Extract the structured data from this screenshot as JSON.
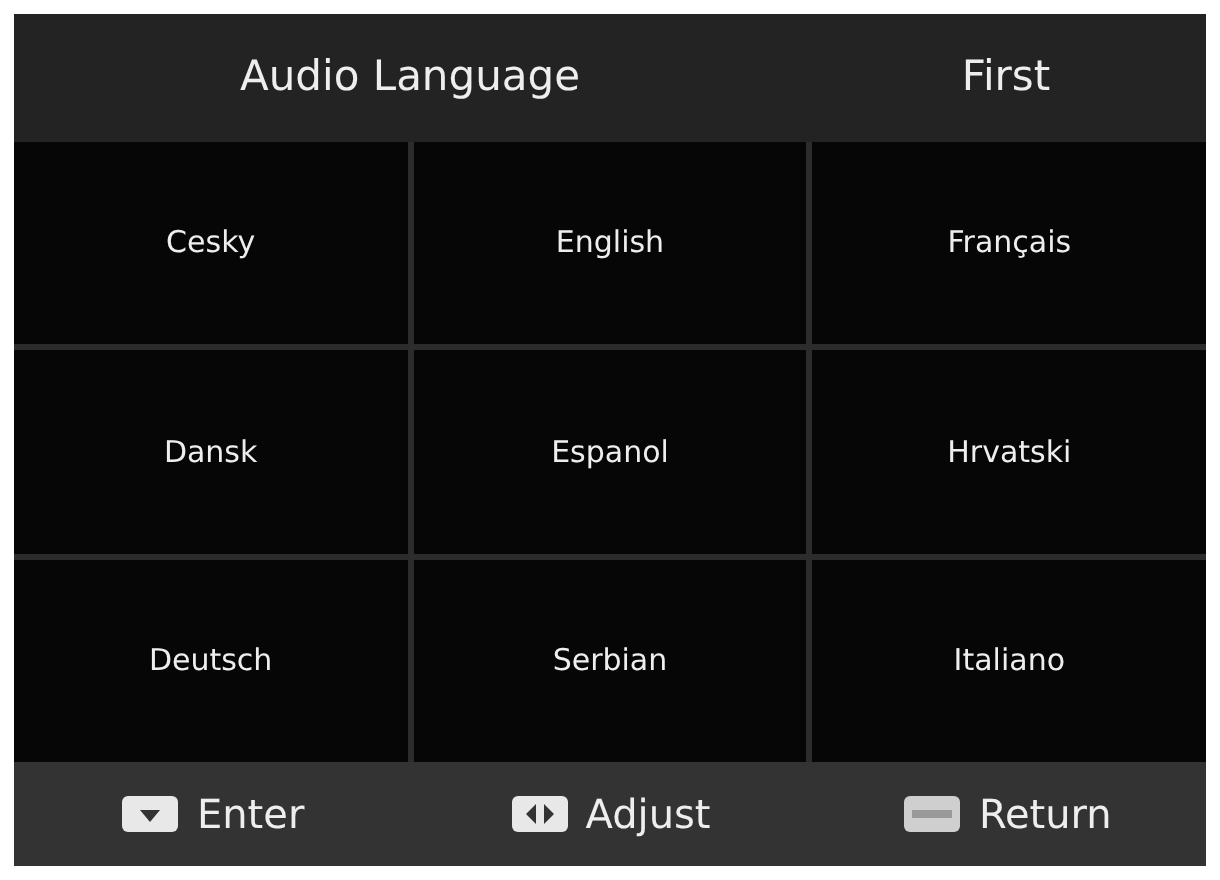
{
  "header": {
    "title": "Audio Language",
    "value": "First"
  },
  "languages": [
    {
      "label": "Cesky"
    },
    {
      "label": "English"
    },
    {
      "label": "Français"
    },
    {
      "label": "Dansk"
    },
    {
      "label": "Espanol"
    },
    {
      "label": "Hrvatski"
    },
    {
      "label": "Deutsch"
    },
    {
      "label": "Serbian"
    },
    {
      "label": "Italiano"
    }
  ],
  "footer": [
    {
      "kind": "down",
      "label": "Enter"
    },
    {
      "kind": "leftright",
      "label": "Adjust"
    },
    {
      "kind": "menu",
      "label": "Return"
    }
  ]
}
